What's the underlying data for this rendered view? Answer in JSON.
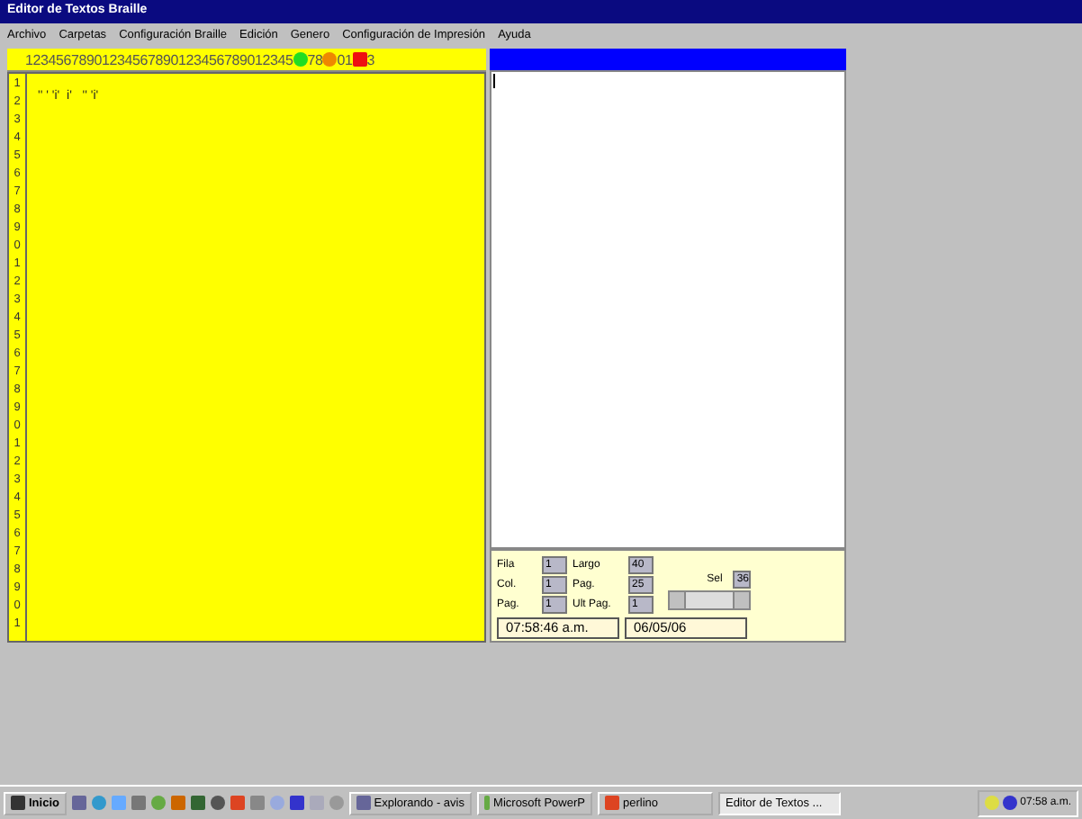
{
  "window": {
    "title": "Editor de Textos Braille"
  },
  "menu": [
    "Archivo",
    "Carpetas",
    "Configuración Braille",
    "Edición",
    "Genero",
    "Configuración de Impresión",
    "Ayuda"
  ],
  "ruler": [
    {
      "kind": "digits",
      "text": "12345678901234567890123456789012345"
    },
    {
      "kind": "circle",
      "color": "#22dd22"
    },
    {
      "kind": "digits",
      "text": "78"
    },
    {
      "kind": "circle",
      "color": "#ee8800"
    },
    {
      "kind": "digits",
      "text": "01"
    },
    {
      "kind": "square",
      "color": "#ee1111"
    },
    {
      "kind": "digits",
      "text": "3"
    }
  ],
  "editor": {
    "line_numbers": [
      "1",
      "2",
      "3",
      "4",
      "5",
      "6",
      "7",
      "8",
      "9",
      "0",
      "1",
      "2",
      "3",
      "4",
      "5",
      "6",
      "7",
      "8",
      "9",
      "0",
      "1",
      "2",
      "3",
      "4",
      "5",
      "6",
      "7",
      "8",
      "9",
      "0",
      "1"
    ],
    "first_line": "'' ' 'i'  i'   '' 'i'"
  },
  "status": {
    "fields": [
      {
        "label": "Fila",
        "value": "1"
      },
      {
        "label": "Largo",
        "value": "40"
      },
      {
        "label": "Col.",
        "value": "1"
      },
      {
        "label": "Pag.",
        "value": "25"
      },
      {
        "label": "Pag.",
        "value": "1"
      },
      {
        "label": "Ult Pag.",
        "value": "1"
      }
    ],
    "sel": {
      "label": "Sel",
      "value": "36"
    },
    "time": "07:58:46 a.m.",
    "date": "06/05/06"
  },
  "taskbar": {
    "start": "Inicio",
    "tasks": [
      {
        "label": "Explorando - avis",
        "selected": false
      },
      {
        "label": "Microsoft PowerP",
        "selected": false
      },
      {
        "label": "perlino",
        "selected": false
      },
      {
        "label": "Editor de Textos ...",
        "selected": true
      }
    ],
    "clock": "07:58 a.m."
  }
}
